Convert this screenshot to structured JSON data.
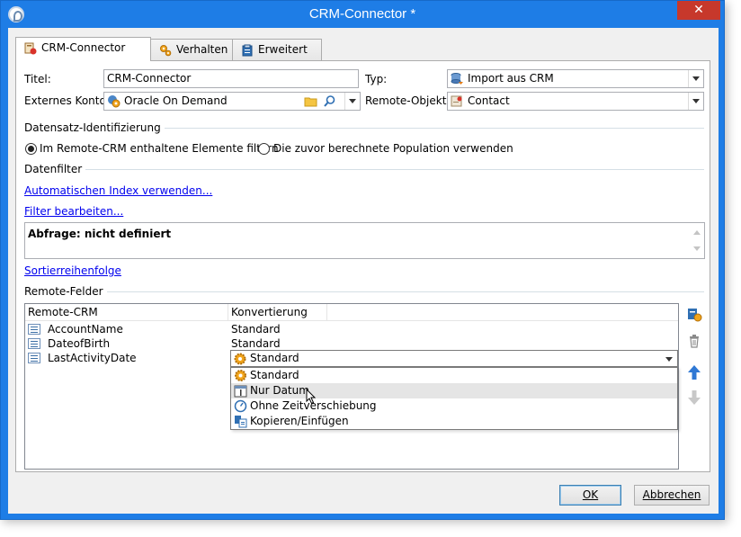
{
  "window": {
    "title": "CRM-Connector *",
    "close_glyph": "✕"
  },
  "tabs": [
    {
      "label": "CRM-Connector",
      "icon": "crm-icon",
      "active": true
    },
    {
      "label": "Verhalten",
      "icon": "gears-icon",
      "active": false
    },
    {
      "label": "Erweitert",
      "icon": "clipboard-icon",
      "active": false
    }
  ],
  "form": {
    "title_label": "Titel:",
    "title_value": "CRM-Connector",
    "type_label": "Typ:",
    "type_value": "Import aus CRM",
    "account_label": "Externes Konto:",
    "account_value": "Oracle On Demand",
    "remote_object_label": "Remote-Objekt:",
    "remote_object_value": "Contact"
  },
  "identification": {
    "section_title": "Datensatz-Identifizierung",
    "option1": "Im Remote-CRM enthaltene Elemente filtern",
    "option2": "Die zuvor berechnete Population verwenden",
    "selected": 1
  },
  "datafilter": {
    "section_title": "Datenfilter",
    "link_auto_index": "Automatischen Index verwenden...",
    "link_edit_filter": "Filter bearbeiten...",
    "query_text": "Abfrage: nicht definiert",
    "link_sort": "Sortierreihenfolge"
  },
  "remote_fields": {
    "section_title": "Remote-Felder",
    "columns": [
      "Remote-CRM",
      "Konvertierung"
    ],
    "rows": [
      {
        "field": "AccountName",
        "conversion": "Standard"
      },
      {
        "field": "DateofBirth",
        "conversion": "Standard"
      },
      {
        "field": "LastActivityDate",
        "conversion": "Standard"
      }
    ],
    "editing_value": "Standard",
    "dropdown_options": [
      {
        "label": "Standard",
        "icon": "gear-icon"
      },
      {
        "label": "Nur Datum",
        "icon": "date-icon"
      },
      {
        "label": "Ohne Zeitverschiebung",
        "icon": "clock-icon"
      },
      {
        "label": "Kopieren/Einfügen",
        "icon": "copy-paste-icon"
      }
    ],
    "hovered_option": 1
  },
  "buttons": {
    "ok": "OK",
    "cancel": "Abbrechen"
  },
  "colors": {
    "titlebar": "#1e7de6",
    "close": "#c7382b",
    "link": "#0000ee"
  }
}
